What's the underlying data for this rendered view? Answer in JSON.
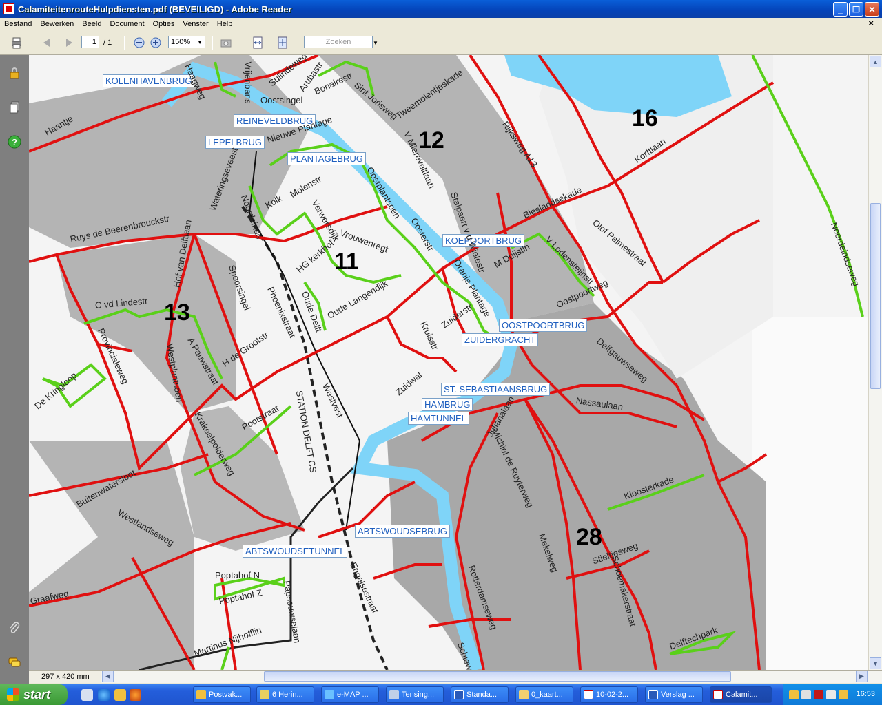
{
  "window": {
    "title": "CalamiteitenrouteHulpdiensten.pdf (BEVEILIGD) - Adobe Reader"
  },
  "menu": [
    "Bestand",
    "Bewerken",
    "Beeld",
    "Document",
    "Opties",
    "Venster",
    "Help"
  ],
  "toolbar": {
    "page_current": "1",
    "page_total": "/ 1",
    "zoom": "150%",
    "search_placeholder": "Zoeken"
  },
  "status": {
    "page_size": "297 x 420 mm"
  },
  "map": {
    "bridges": [
      "KOLENHAVENBRUG",
      "REINEVELDBRUG",
      "LEPELBRUG",
      "PLANTAGEBRUG",
      "KOEPOORTBRUG",
      "OOSTPOORTBRUG",
      "ZUIDERGRACHT",
      "ST. SEBASTIAANSBRUG",
      "HAMBRUG",
      "HAMTUNNEL",
      "ABTSWOUDSEBRUG",
      "ABTSWOUDSETUNNEL"
    ],
    "zones": [
      "16",
      "12",
      "11",
      "13",
      "28"
    ],
    "streets": [
      "Haagweg",
      "Vrijenbans",
      "Sulindeweg",
      "Arubastr",
      "Bonairestr",
      "Sint Jorisweg",
      "Tweemolentjeskade",
      "Oostsingel",
      "Haantje",
      "Nieuwe Plantage",
      "V Miereveltlaan",
      "Rijksweg A13",
      "Korftlaan",
      "Wateringseveest",
      "Noordeinde",
      "Kolk",
      "Molenstr",
      "Verwersdijk",
      "Oostplantsoen",
      "Oosterstr",
      "Stalpaert v d Wielestr",
      "Bieslandsekade",
      "Olof Palmestraat",
      "Noordeindseweg",
      "Ruys de Beerenbrouckstr",
      "Hof van Delftlaan",
      "Vrouwenregt",
      "Spoorsingel",
      "Phoenixstraat",
      "HG kerkhof",
      "Oude Delft",
      "Oude Langendijk",
      "Oranje Plantage",
      "M Duijstln",
      "V Lodensteijnstr",
      "Oostpoortweg",
      "C vd Lindestr",
      "Provincialeweg",
      "A Pauwstraat",
      "Westplantsoen",
      "H de Grootstr",
      "Kruisstr",
      "Zuiderstr",
      "Delfgauwseweg",
      "De Kringloop",
      "STATION DELFT CS",
      "Westvest",
      "Zuidwal",
      "Nassaulaan",
      "Krakeelpolderweg",
      "Pootstraat",
      "Julianalaan",
      "Michiel de Ruyterweg",
      "Buitenwatersloot",
      "Westlandseweg",
      "Kloosterkade",
      "Mekelweg",
      "Stieltjesweg",
      "Schoemakerstraat",
      "Rotterdamseweg",
      "Engelsestraat",
      "Poptahof N",
      "Poptahof Z",
      "Papsouwselaan",
      "Graafweg",
      "Martinus Nijhofflin",
      "Delftechpark",
      "Schieweg"
    ]
  },
  "taskbar": {
    "start": "start",
    "tasks": [
      "Postvak...",
      "6 Herin...",
      "e-MAP ...",
      "Tensing...",
      "Standa...",
      "0_kaart...",
      "10-02-2...",
      "Verslag ...",
      "Calamit..."
    ],
    "clock": "16:53"
  }
}
